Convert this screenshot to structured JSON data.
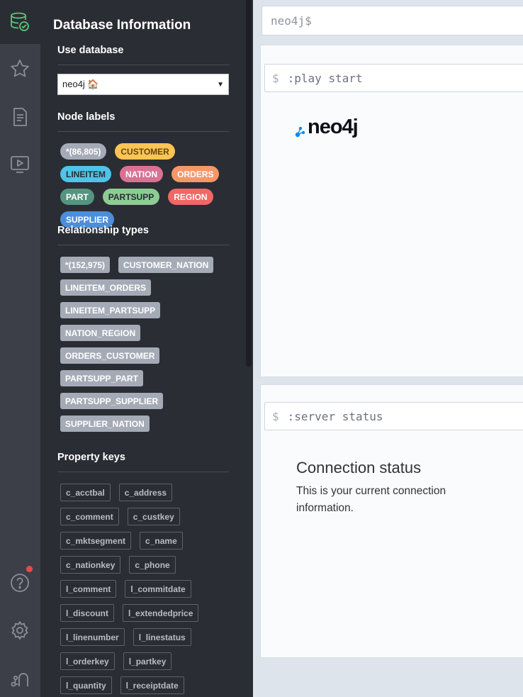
{
  "icons": {
    "db": "database-check-icon",
    "favorites": "star-icon",
    "documents": "document-icon",
    "guides": "play-screen-icon",
    "help": "help-circle-icon",
    "settings": "gear-icon",
    "about": "neo4j-mark-icon"
  },
  "colors": {
    "rail": "#3d3f48",
    "drawer": "#2b2d34",
    "accent_green": "#58c67a",
    "notification": "#e64a4a"
  },
  "drawer": {
    "title": "Database Information",
    "use_database": {
      "title": "Use database",
      "selected": "neo4j 🏠"
    },
    "node_labels": {
      "title": "Node labels",
      "items": [
        {
          "label": "*(86,805)",
          "bg": "#a5abb6",
          "fg": "#ffffff"
        },
        {
          "label": "CUSTOMER",
          "bg": "#ffc454",
          "fg": "#604a0e"
        },
        {
          "label": "LINEITEM",
          "bg": "#4fc3e8",
          "fg": "#2a2c34"
        },
        {
          "label": "NATION",
          "bg": "#da7194",
          "fg": "#ffffff"
        },
        {
          "label": "ORDERS",
          "bg": "#f79767",
          "fg": "#ffffff"
        },
        {
          "label": "PART",
          "bg": "#569480",
          "fg": "#ffffff"
        },
        {
          "label": "PARTSUPP",
          "bg": "#8dcc93",
          "fg": "#2a2c34"
        },
        {
          "label": "REGION",
          "bg": "#f16667",
          "fg": "#ffffff"
        },
        {
          "label": "SUPPLIER",
          "bg": "#4c8eda",
          "fg": "#ffffff"
        }
      ]
    },
    "relationship_types": {
      "title": "Relationship types",
      "items": [
        "*(152,975)",
        "CUSTOMER_NATION",
        "LINEITEM_ORDERS",
        "LINEITEM_PARTSUPP",
        "NATION_REGION",
        "ORDERS_CUSTOMER",
        "PARTSUPP_PART",
        "PARTSUPP_SUPPLIER",
        "SUPPLIER_NATION"
      ]
    },
    "property_keys": {
      "title": "Property keys",
      "items": [
        "c_acctbal",
        "c_address",
        "c_comment",
        "c_custkey",
        "c_mktsegment",
        "c_name",
        "c_nationkey",
        "c_phone",
        "l_comment",
        "l_commitdate",
        "l_discount",
        "l_extendedprice",
        "l_linenumber",
        "l_linestatus",
        "l_orderkey",
        "l_partkey",
        "l_quantity",
        "l_receiptdate"
      ]
    }
  },
  "main": {
    "editor_prompt": "neo4j$",
    "frames": [
      {
        "prompt": "$",
        "command": ":play start",
        "logo": "neo4j"
      },
      {
        "prompt": "$",
        "command": ":server status",
        "heading": "Connection status",
        "body": "This is your current connection information."
      }
    ]
  }
}
